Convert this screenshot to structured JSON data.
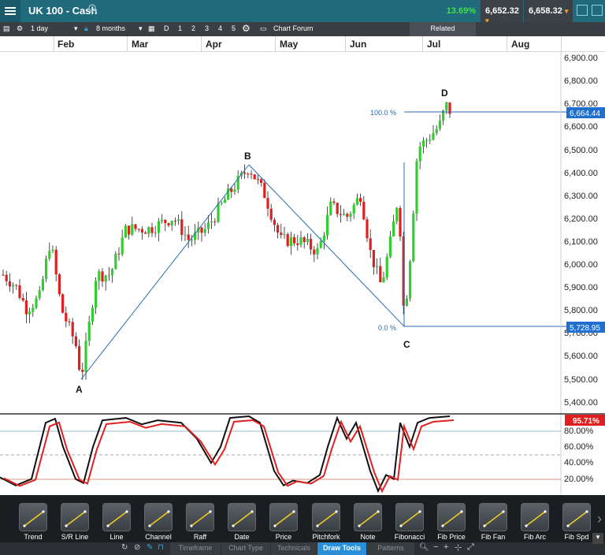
{
  "header": {
    "instrument": "UK 100 - Cash",
    "change_pct": "13.69%",
    "sell_price": "6,652.32",
    "buy_price": "6,658.32",
    "search_icon": "search-icon",
    "menu_icon": "hamburger-menu-icon"
  },
  "toolbar": {
    "interval": "1 day",
    "range": "8 months",
    "timeframes": [
      "D",
      "1",
      "2",
      "3",
      "4",
      "5"
    ],
    "chart_forum": "Chart Forum",
    "related": "Related"
  },
  "months": [
    "Feb",
    "Mar",
    "Apr",
    "May",
    "Jun",
    "Jul",
    "Aug"
  ],
  "price_axis": {
    "ticks": [
      "6,900.00",
      "6,800.00",
      "6,700.00",
      "6,600.00",
      "6,500.00",
      "6,400.00",
      "6,300.00",
      "6,200.00",
      "6,100.00",
      "6,000.00",
      "5,900.00",
      "5,800.00",
      "5,700.00",
      "5,600.00",
      "5,500.00",
      "5,400.00"
    ],
    "current_tag": "6,664.44",
    "low_tag": "5,728.95"
  },
  "fib": {
    "level_100": "100.0 %",
    "level_0": "0.0 %",
    "points": [
      "A",
      "B",
      "C",
      "D"
    ]
  },
  "oscillator": {
    "value_tag": "95.71%",
    "ticks": [
      "80.00%",
      "60.00%",
      "40.00%",
      "20.00%"
    ]
  },
  "draw_tools": [
    "Trend",
    "S/R Line",
    "Line",
    "Channel",
    "Raff",
    "Date",
    "Price",
    "Pitchfork",
    "Note",
    "Fibonacci",
    "Fib Price",
    "Fib Fan",
    "Fib Arc",
    "Fib Spd"
  ],
  "bottom_tabs": [
    "Timeframe",
    "Chart Type",
    "Technicals",
    "Draw Tools",
    "Patterns"
  ],
  "active_tab": "Draw Tools",
  "colors": {
    "up": "#33cc33",
    "down": "#e02020",
    "fib_line": "#2b6cb0",
    "accent": "#2a8fd8",
    "title_bar": "#1f6b7b"
  }
}
